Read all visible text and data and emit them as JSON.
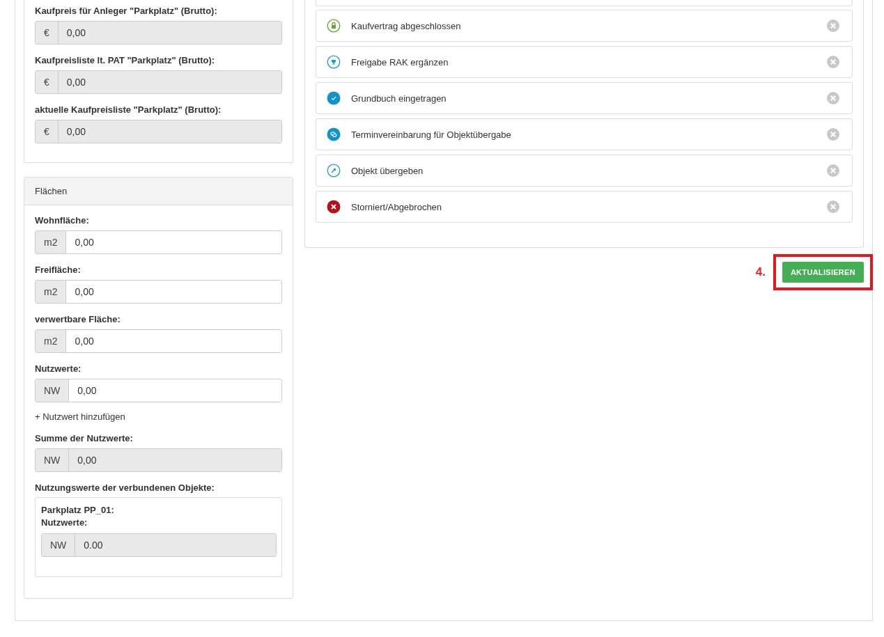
{
  "price_fields": [
    {
      "label": "Kaufpreis für Anleger \"Parkplatz\" (Brutto):",
      "addon": "€",
      "value": "0,00",
      "readonly": true
    },
    {
      "label": "Kaufpreisliste lt. PAT \"Parkplatz\" (Brutto):",
      "addon": "€",
      "value": "0,00",
      "readonly": true
    },
    {
      "label": "aktuelle Kaufpreisliste \"Parkplatz\" (Brutto):",
      "addon": "€",
      "value": "0,00",
      "readonly": true
    }
  ],
  "areas": {
    "title": "Flächen",
    "fields": [
      {
        "label": "Wohnfläche:",
        "addon": "m2",
        "value": "0,00",
        "readonly": false
      },
      {
        "label": "Freifläche:",
        "addon": "m2",
        "value": "0,00",
        "readonly": false
      },
      {
        "label": "verwertbare Fläche:",
        "addon": "m2",
        "value": "0,00",
        "readonly": false
      },
      {
        "label": "Nutzwerte:",
        "addon": "NW",
        "value": "0,00",
        "readonly": false
      }
    ],
    "add_link": "+ Nutzwert hinzufügen",
    "sum_field": {
      "label": "Summe der Nutzwerte:",
      "addon": "NW",
      "value": "0,00",
      "readonly": true
    },
    "linked": {
      "label": "Nutzungswerte der verbundenen Objekte:",
      "object": "Parkplatz PP_01:",
      "sublabel": "Nutzwerte:",
      "field": {
        "addon": "NW",
        "value": "0.00",
        "readonly": true
      }
    }
  },
  "statuses": [
    {
      "kind": "lock",
      "label": "Kaufvertrag abgeschlossen"
    },
    {
      "kind": "trophy",
      "label": "Freigabe RAK ergänzen"
    },
    {
      "kind": "check",
      "label": "Grundbuch eingetragen"
    },
    {
      "kind": "chat",
      "label": "Terminvereinbarung für Objektübergabe"
    },
    {
      "kind": "key",
      "label": "Objekt übergeben"
    },
    {
      "kind": "cancel",
      "label": "Storniert/Abgebrochen"
    }
  ],
  "step_marker": "4.",
  "update_button": "AKTUALISIEREN"
}
